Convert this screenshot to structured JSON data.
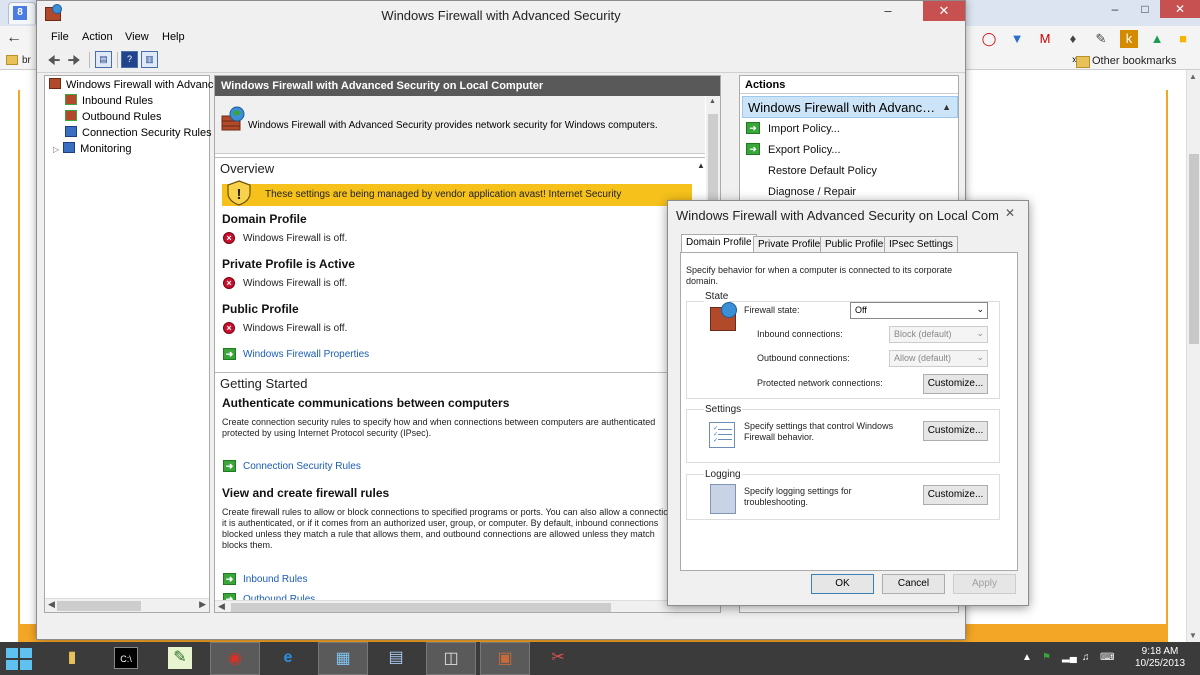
{
  "chrome": {
    "tab_icon": "google-g-icon",
    "tab_icon_text": "8",
    "bookmark_partial": "br",
    "other_bookmarks": "Other bookmarks",
    "more_bookmarks": "»",
    "extension_icons": [
      "opera-icon",
      "vivaldi-icon",
      "gmail-icon",
      "puzzle-icon",
      "pin-icon",
      "k-icon",
      "drive-icon",
      "keep-icon",
      "menu-icon"
    ]
  },
  "mmc": {
    "title": "Windows Firewall with Advanced Security",
    "menu": [
      "File",
      "Action",
      "View",
      "Help"
    ],
    "tree": {
      "root": "Windows Firewall with Advanced Security on Local Computer",
      "items": [
        "Inbound Rules",
        "Outbound Rules",
        "Connection Security Rules",
        "Monitoring"
      ]
    },
    "center": {
      "header": "Windows Firewall with Advanced Security on Local Computer",
      "intro": "Windows Firewall with Advanced Security provides network security for Windows computers.",
      "overview_title": "Overview",
      "warning": "These settings are being managed by vendor application avast! Internet Security",
      "profiles": [
        {
          "name": "Domain Profile",
          "status": "Windows Firewall is off."
        },
        {
          "name": "Private Profile is Active",
          "status": "Windows Firewall is off."
        },
        {
          "name": "Public Profile",
          "status": "Windows Firewall is off."
        }
      ],
      "properties_link": "Windows Firewall Properties",
      "getting_started_title": "Getting Started",
      "auth_title": "Authenticate communications between computers",
      "auth_para": [
        "Create connection security rules to specify how and when connections between computers are authenticated",
        "protected by using Internet Protocol security (IPsec)."
      ],
      "conn_link": "Connection Security Rules",
      "rules_title": "View and create firewall rules",
      "rules_para": [
        "Create firewall rules to allow or block connections to specified programs or ports. You can also allow a connection",
        "it is authenticated, or if it comes from an authorized user, group, or computer. By default, inbound connections",
        "blocked unless they match a rule that allows them, and outbound connections are allowed unless they match",
        "blocks them."
      ],
      "inbound_link": "Inbound Rules",
      "outbound_link_partial": "Outbound Rules"
    },
    "actions": {
      "header": "Actions",
      "selected": "Windows Firewall with Advanced Security on Local Computer",
      "items": [
        "Import Policy...",
        "Export Policy...",
        "Restore Default Policy",
        "Diagnose / Repair"
      ]
    }
  },
  "dialog": {
    "title": "Windows Firewall with Advanced Security on Local Computer Properties",
    "tabs": [
      "Domain Profile",
      "Private Profile",
      "Public Profile",
      "IPsec Settings"
    ],
    "description": "Specify behavior for when a computer is connected to its corporate domain.",
    "state_label": "State",
    "firewall_state_label": "Firewall state:",
    "firewall_state_value": "Off",
    "inbound_label": "Inbound connections:",
    "inbound_value": "Block (default)",
    "outbound_label": "Outbound connections:",
    "outbound_value": "Allow (default)",
    "protected_label": "Protected network connections:",
    "customize": "Customize...",
    "settings_label": "Settings",
    "settings_desc": "Specify settings that control Windows Firewall behavior.",
    "logging_label": "Logging",
    "logging_desc": "Specify logging settings for troubleshooting.",
    "ok": "OK",
    "cancel": "Cancel",
    "apply": "Apply"
  },
  "taskbar": {
    "time": "9:18 AM",
    "date": "10/25/2013"
  }
}
